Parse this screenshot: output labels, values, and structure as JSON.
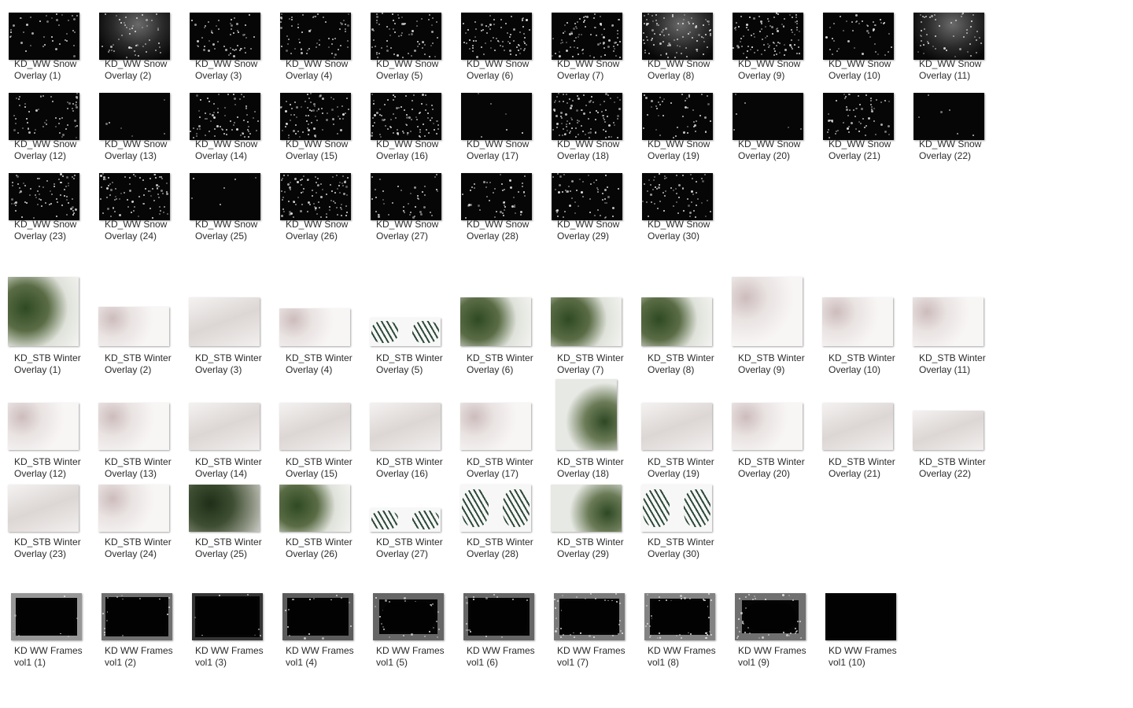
{
  "explorer": {
    "snow": [
      {
        "line1": "KD_WW Snow",
        "line2": "Overlay (1)"
      },
      {
        "line1": "KD_WW Snow",
        "line2": "Overlay (2)"
      },
      {
        "line1": "KD_WW Snow",
        "line2": "Overlay (3)"
      },
      {
        "line1": "KD_WW Snow",
        "line2": "Overlay (4)"
      },
      {
        "line1": "KD_WW Snow",
        "line2": "Overlay (5)"
      },
      {
        "line1": "KD_WW Snow",
        "line2": "Overlay (6)"
      },
      {
        "line1": "KD_WW Snow",
        "line2": "Overlay (7)"
      },
      {
        "line1": "KD_WW Snow",
        "line2": "Overlay (8)"
      },
      {
        "line1": "KD_WW Snow",
        "line2": "Overlay (9)"
      },
      {
        "line1": "KD_WW Snow",
        "line2": "Overlay (10)"
      },
      {
        "line1": "KD_WW Snow",
        "line2": "Overlay (11)"
      },
      {
        "line1": "KD_WW Snow",
        "line2": "Overlay (12)"
      },
      {
        "line1": "KD_WW Snow",
        "line2": "Overlay (13)"
      },
      {
        "line1": "KD_WW Snow",
        "line2": "Overlay (14)"
      },
      {
        "line1": "KD_WW Snow",
        "line2": "Overlay (15)"
      },
      {
        "line1": "KD_WW Snow",
        "line2": "Overlay (16)"
      },
      {
        "line1": "KD_WW Snow",
        "line2": "Overlay (17)"
      },
      {
        "line1": "KD_WW Snow",
        "line2": "Overlay (18)"
      },
      {
        "line1": "KD_WW Snow",
        "line2": "Overlay (19)"
      },
      {
        "line1": "KD_WW Snow",
        "line2": "Overlay (20)"
      },
      {
        "line1": "KD_WW Snow",
        "line2": "Overlay (21)"
      },
      {
        "line1": "KD_WW Snow",
        "line2": "Overlay (22)"
      },
      {
        "line1": "KD_WW Snow",
        "line2": "Overlay (23)"
      },
      {
        "line1": "KD_WW Snow",
        "line2": "Overlay (24)"
      },
      {
        "line1": "KD_WW Snow",
        "line2": "Overlay (25)"
      },
      {
        "line1": "KD_WW Snow",
        "line2": "Overlay (26)"
      },
      {
        "line1": "KD_WW Snow",
        "line2": "Overlay (27)"
      },
      {
        "line1": "KD_WW Snow",
        "line2": "Overlay (28)"
      },
      {
        "line1": "KD_WW Snow",
        "line2": "Overlay (29)"
      },
      {
        "line1": "KD_WW Snow",
        "line2": "Overlay (30)"
      }
    ],
    "winter": [
      {
        "line1": "KD_STB Winter",
        "line2": "Overlay (1)"
      },
      {
        "line1": "KD_STB Winter",
        "line2": "Overlay (2)"
      },
      {
        "line1": "KD_STB Winter",
        "line2": "Overlay (3)"
      },
      {
        "line1": "KD_STB Winter",
        "line2": "Overlay (4)"
      },
      {
        "line1": "KD_STB Winter",
        "line2": "Overlay (5)"
      },
      {
        "line1": "KD_STB Winter",
        "line2": "Overlay (6)"
      },
      {
        "line1": "KD_STB Winter",
        "line2": "Overlay (7)"
      },
      {
        "line1": "KD_STB Winter",
        "line2": "Overlay (8)"
      },
      {
        "line1": "KD_STB Winter",
        "line2": "Overlay (9)"
      },
      {
        "line1": "KD_STB Winter",
        "line2": "Overlay (10)"
      },
      {
        "line1": "KD_STB Winter",
        "line2": "Overlay (11)"
      },
      {
        "line1": "KD_STB Winter",
        "line2": "Overlay (12)"
      },
      {
        "line1": "KD_STB Winter",
        "line2": "Overlay (13)"
      },
      {
        "line1": "KD_STB Winter",
        "line2": "Overlay (14)"
      },
      {
        "line1": "KD_STB Winter",
        "line2": "Overlay (15)"
      },
      {
        "line1": "KD_STB Winter",
        "line2": "Overlay (16)"
      },
      {
        "line1": "KD_STB Winter",
        "line2": "Overlay (17)"
      },
      {
        "line1": "KD_STB Winter",
        "line2": "Overlay (18)"
      },
      {
        "line1": "KD_STB Winter",
        "line2": "Overlay (19)"
      },
      {
        "line1": "KD_STB Winter",
        "line2": "Overlay (20)"
      },
      {
        "line1": "KD_STB Winter",
        "line2": "Overlay (21)"
      },
      {
        "line1": "KD_STB Winter",
        "line2": "Overlay (22)"
      },
      {
        "line1": "KD_STB Winter",
        "line2": "Overlay (23)"
      },
      {
        "line1": "KD_STB Winter",
        "line2": "Overlay (24)"
      },
      {
        "line1": "KD_STB Winter",
        "line2": "Overlay (25)"
      },
      {
        "line1": "KD_STB Winter",
        "line2": "Overlay (26)"
      },
      {
        "line1": "KD_STB Winter",
        "line2": "Overlay (27)"
      },
      {
        "line1": "KD_STB Winter",
        "line2": "Overlay (28)"
      },
      {
        "line1": "KD_STB Winter",
        "line2": "Overlay (29)"
      },
      {
        "line1": "KD_STB Winter",
        "line2": "Overlay (30)"
      }
    ],
    "frames": [
      {
        "line1": "KD WW Frames",
        "line2": "vol1 (1)"
      },
      {
        "line1": "KD WW Frames",
        "line2": "vol1 (2)"
      },
      {
        "line1": "KD WW Frames",
        "line2": "vol1 (3)"
      },
      {
        "line1": "KD WW Frames",
        "line2": "vol1 (4)"
      },
      {
        "line1": "KD WW Frames",
        "line2": "vol1 (5)"
      },
      {
        "line1": "KD WW Frames",
        "line2": "vol1 (6)"
      },
      {
        "line1": "KD WW Frames",
        "line2": "vol1 (7)"
      },
      {
        "line1": "KD WW Frames",
        "line2": "vol1 (8)"
      },
      {
        "line1": "KD WW Frames",
        "line2": "vol1 (9)"
      },
      {
        "line1": "KD WW Frames",
        "line2": "vol1 (10)"
      }
    ]
  }
}
